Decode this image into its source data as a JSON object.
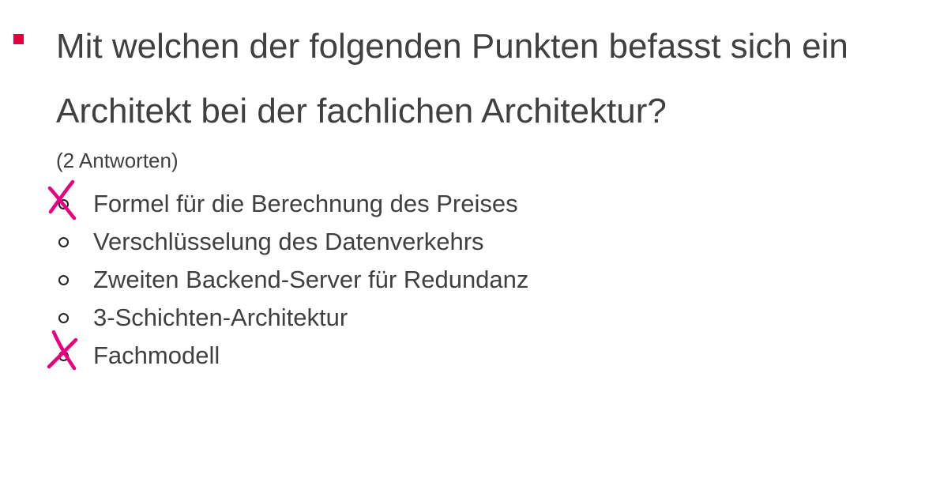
{
  "slide": {
    "bullet_color": "#e2003d",
    "question": "Mit welchen der folgenden Punkten befasst sich ein Architekt bei der fachlichen Architektur?",
    "hint": "(2 Antworten)",
    "mark_color": "#e8007f",
    "marker_icon": "circle-outline-icon",
    "check_icon": "handwritten-x-icon",
    "options": [
      {
        "label": "Formel für die Berechnung des Preises",
        "marked": true
      },
      {
        "label": "Verschlüsselung des Datenverkehrs",
        "marked": false
      },
      {
        "label": "Zweiten Backend-Server für Redundanz",
        "marked": false
      },
      {
        "label": "3-Schichten-Architektur",
        "marked": false
      },
      {
        "label": "Fachmodell",
        "marked": true
      }
    ]
  }
}
